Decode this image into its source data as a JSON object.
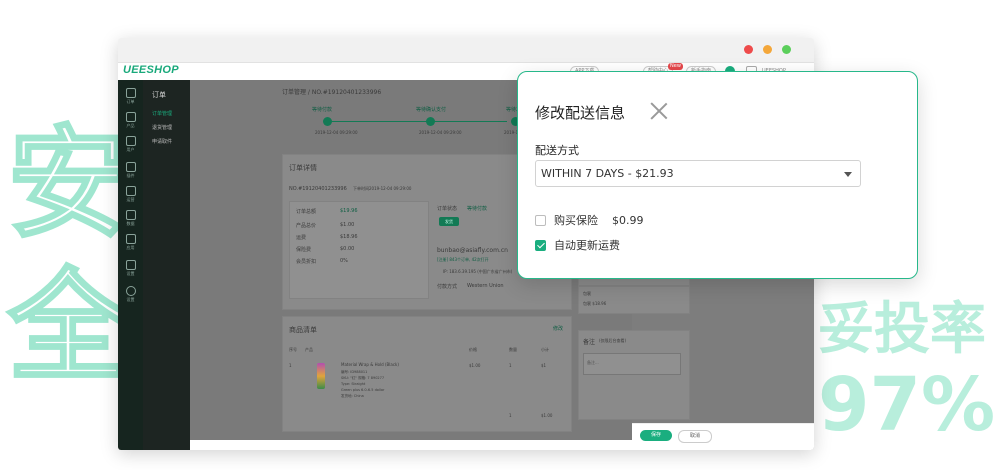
{
  "background": {
    "left_chars": [
      "安",
      "全"
    ],
    "right_line1": "妥投率",
    "right_line2": "97%"
  },
  "browser": {
    "controls": {
      "red": "#ee4b4b",
      "orange": "#f4a73a",
      "green": "#5bcf5b"
    },
    "app": {
      "logo": "UEESHOP",
      "header_pills": [
        "APP下载",
        "帮助中心",
        "新手指南"
      ],
      "new_badge": "New",
      "user": "UEESHOP"
    },
    "sidebar": {
      "items": [
        "订单",
        "产品",
        "用户",
        "插件",
        "运营",
        "数据",
        "设置",
        "应用",
        "设置"
      ]
    },
    "subnav": {
      "title": "订单",
      "items": [
        "订单管理",
        "退货管理",
        "申请取件"
      ]
    },
    "content": {
      "breadcrumb": "订单管理 / NO.#19120401233996",
      "steps": [
        "等待付款",
        "等待确认支付",
        "等待发货"
      ],
      "step_dates": [
        "2019-12-04 09:29:00",
        "2019-12-04 09:29:00",
        "2019-12-04 09:29:00"
      ],
      "order_detail_title": "订单详情",
      "order_no": "NO.#19120401233996",
      "order_time": "下单时间2019-12-04 09:29:00",
      "rows": [
        {
          "label": "订单总额",
          "value": "$19.96"
        },
        {
          "label": "产品总价",
          "value": "$1.00"
        },
        {
          "label": "运费",
          "value": "$18.96"
        },
        {
          "label": "保险费",
          "value": "$0.00"
        },
        {
          "label": "会员折扣",
          "value": "0%"
        }
      ],
      "status_label": "订单状态",
      "status_value": "等待付款",
      "status_button": "发货",
      "email": "bunbao@asiafly.com.cn",
      "email_sub": "[注册] 843个订单, 42次打开",
      "ip": "IP: 183.6.39.195 (中国广东省广州市)",
      "pay_method_label": "付款方式",
      "pay_method": "Western Union",
      "product_list_title": "商品清单",
      "product_list_action": "修改",
      "table_headers": [
        "序号",
        "产品",
        "价格",
        "数量",
        "小计"
      ],
      "product": {
        "index": "1",
        "name": "Material Wrap & Hold (Black)",
        "lines": [
          "编号: ID988011",
          "SKU: \"红\" 规格: 7 890277",
          "Type: Straight",
          "Green plus 6.0-6.5 dollar",
          "发货地: China"
        ],
        "price": "$1.00",
        "qty": "1",
        "subtotal": "$1"
      },
      "product_total_qty": "1",
      "product_total": "$1.00",
      "logistics_label": "物流方式: Within 7 days",
      "logistics_price": "$18.96",
      "package_label": "包裹",
      "package_value": "包裹 $18.96",
      "remark_title": "备注",
      "remark_sub": "(仅限后台查看)",
      "remark_placeholder": "备注..."
    },
    "footer": {
      "save": "保存",
      "cancel": "取消"
    }
  },
  "modal": {
    "title": "修改配送信息",
    "shipping_label": "配送方式",
    "shipping_selected": "WITHIN 7 DAYS - $21.93",
    "insurance_label": "购买保险",
    "insurance_price": "$0.99",
    "insurance_checked": false,
    "auto_update_label": "自动更新运费",
    "auto_update_checked": true,
    "accent": "#1aae7f"
  }
}
